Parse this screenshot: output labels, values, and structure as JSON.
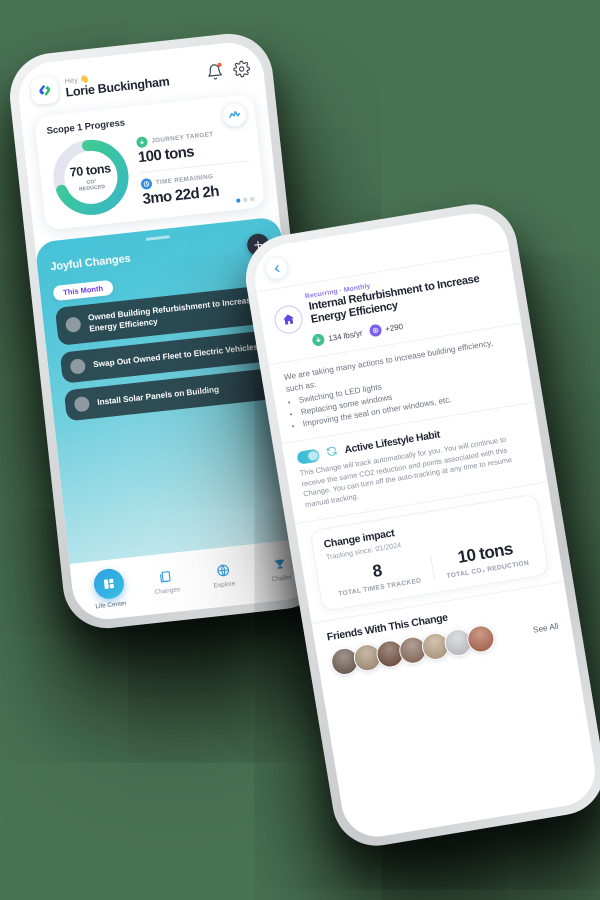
{
  "theme": {
    "background": "#4a7353",
    "accent_blue": "#2f8ce0",
    "accent_teal": "#46c2d6",
    "accent_green": "#3dc18f",
    "accent_purple": "#7b5cf0",
    "dark_card": "#263a42"
  },
  "phone_left": {
    "header": {
      "logo": "app-logo",
      "greeting": "Hey 👋",
      "user_name": "Lorie Buckingham",
      "notification_icon": "bell-icon",
      "settings_icon": "gear-icon"
    },
    "progress_card": {
      "title": "Scope 1 Progress",
      "chart_icon": "line-chart-icon",
      "ring": {
        "value": "70 tons",
        "sub_line1": "CO²",
        "sub_line2": "REDUCED",
        "percent": 70
      },
      "stats": [
        {
          "icon": "download-arrow-icon",
          "caption": "JOURNEY TARGET",
          "value": "100 tons"
        },
        {
          "icon": "clock-icon",
          "caption": "TIME REMAINING",
          "value": "3mo 22d 2h"
        }
      ],
      "pager": {
        "total": 3,
        "active": 1
      }
    },
    "joyful": {
      "title": "Joyful Changes",
      "add_label": "+",
      "filter_pill": "This Month",
      "items": [
        {
          "title": "Owned Building Refurbishment to Increase Energy Efficiency"
        },
        {
          "title": "Swap Out Owned Fleet to Electric Vehicles"
        },
        {
          "title": "Install Solar Panels on Building"
        }
      ]
    },
    "tabbar": [
      {
        "icon": "dashboard-icon",
        "label": "Life Center",
        "active": true
      },
      {
        "icon": "book-icon",
        "label": "Changes",
        "active": false
      },
      {
        "icon": "globe-icon",
        "label": "Explore",
        "active": false
      },
      {
        "icon": "trophy-icon",
        "label": "Challer",
        "active": false
      }
    ]
  },
  "phone_right": {
    "nav": {
      "back_icon": "chevron-left-icon"
    },
    "change": {
      "recurrence": "Recurring · Monthly",
      "icon": "home-icon",
      "title": "Internal Refurbishment to Increase Energy Efficiency",
      "badges": [
        {
          "icon": "download-arrow-icon",
          "text": "134 lbs/yr"
        },
        {
          "icon": "points-icon",
          "text": "+290"
        }
      ],
      "description_intro": "We are taking many actions to increase building efficiency, such as:",
      "description_bullets": [
        "Switching to LED lights",
        "Replacing some windows",
        "Improving the seal on other windows, etc."
      ]
    },
    "habit": {
      "toggle_on": true,
      "refresh_icon": "refresh-icon",
      "title": "Active Lifestyle Habit",
      "description": "This Change will track automatically for you. You will continue to receive the same CO2 reduction and points associated with this Change. You can turn off the auto-tracking at any time to resume manual tracking."
    },
    "impact": {
      "title": "Change impact",
      "subtitle": "Tracking since: 01/2024",
      "metrics": [
        {
          "value": "8",
          "caption": "TOTAL TIMES TRACKED"
        },
        {
          "value": "10 tons",
          "caption": "TOTAL CO₂ REDUCTION"
        }
      ]
    },
    "friends": {
      "title": "Friends With This Change",
      "see_all": "See All",
      "avatars": [
        {
          "name": "friend-avatar-1",
          "color": "#6b5a4e"
        },
        {
          "name": "friend-avatar-2",
          "color": "#a89277"
        },
        {
          "name": "friend-avatar-3",
          "color": "#6f4b3a"
        },
        {
          "name": "friend-avatar-4",
          "color": "#8a6a58"
        },
        {
          "name": "friend-avatar-5",
          "color": "#b9a183"
        },
        {
          "name": "friend-avatar-6",
          "color": "#c9cbcf"
        },
        {
          "name": "friend-avatar-7",
          "color": "#b0654a"
        }
      ]
    }
  }
}
